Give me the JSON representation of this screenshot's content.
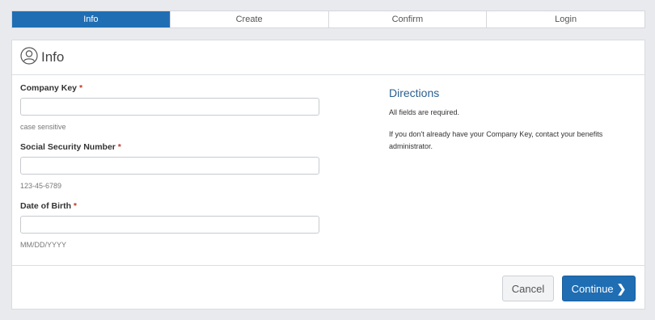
{
  "steps": [
    {
      "label": "Info",
      "active": true
    },
    {
      "label": "Create",
      "active": false
    },
    {
      "label": "Confirm",
      "active": false
    },
    {
      "label": "Login",
      "active": false
    }
  ],
  "header": {
    "title": "Info",
    "icon": "user-icon"
  },
  "form": {
    "company_key": {
      "label": "Company Key",
      "required_mark": "*",
      "value": "",
      "hint": "case sensitive"
    },
    "ssn": {
      "label": "Social Security Number",
      "required_mark": "*",
      "value": "",
      "hint": "123-45-6789"
    },
    "dob": {
      "label": "Date of Birth",
      "required_mark": "*",
      "value": "",
      "hint": "MM/DD/YYYY"
    }
  },
  "directions": {
    "title": "Directions",
    "line1": "All fields are required.",
    "line2": "If you don't already have your Company Key, contact your benefits administrator."
  },
  "footer": {
    "cancel_label": "Cancel",
    "continue_label": "Continue",
    "continue_icon": "chevron-right-icon"
  },
  "colors": {
    "accent": "#1f6db3",
    "required": "#c0392b",
    "directions_title": "#2b5f8f"
  }
}
